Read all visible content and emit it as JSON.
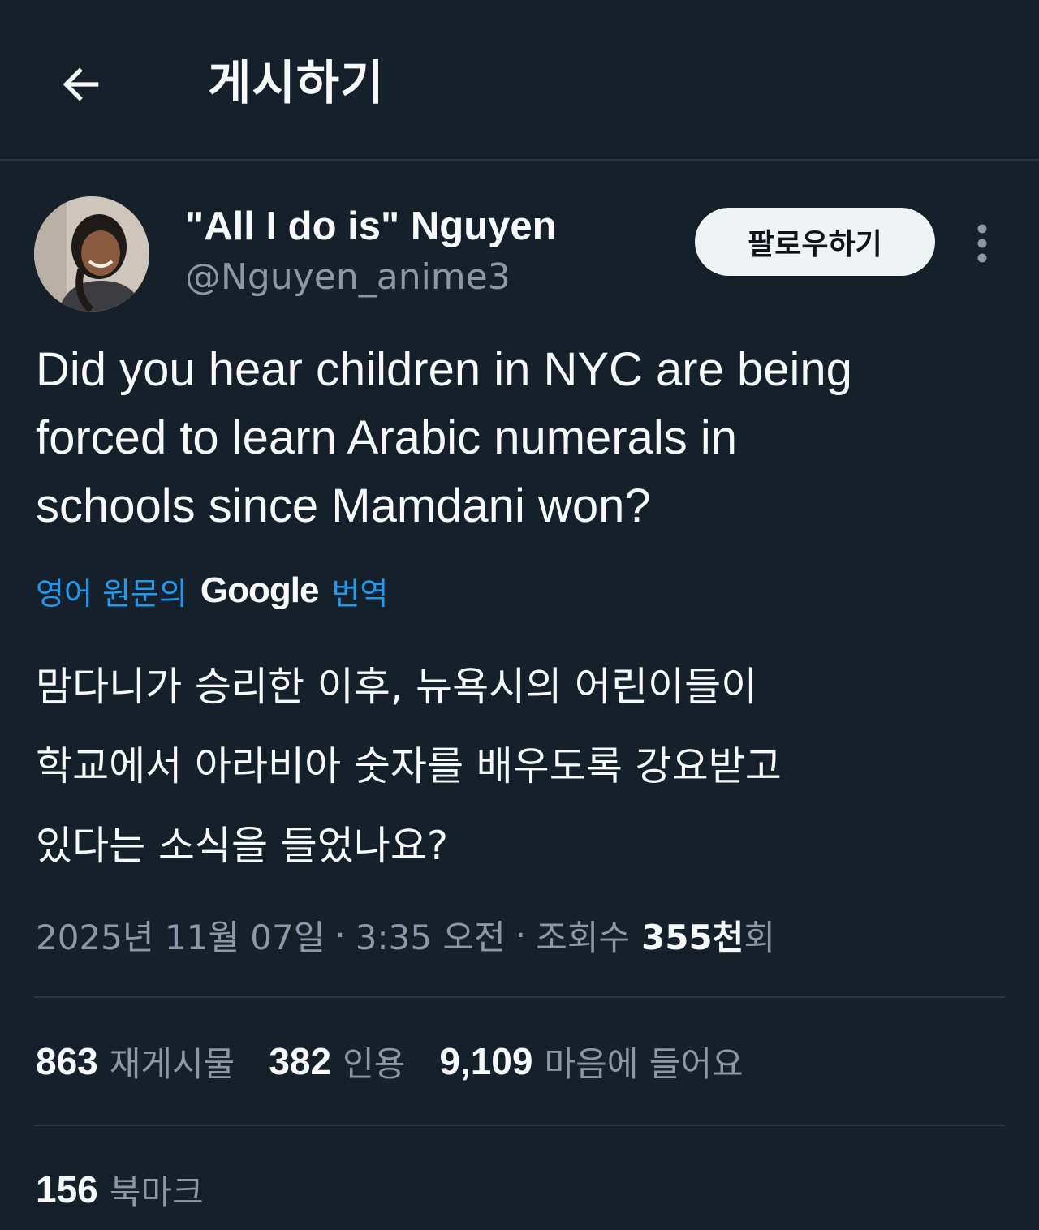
{
  "header": {
    "back_icon": "arrow-left-icon",
    "title": "게시하기"
  },
  "author": {
    "display_name": "\"All I do is\" Nguyen",
    "handle": "@Nguyen_anime3",
    "follow_label": "팔로우하기",
    "more_icon": "more-vertical-icon"
  },
  "tweet": {
    "text_lines": [
      "Did you hear children in NYC are being",
      "forced to learn Arabic numerals in",
      "schools since Mamdani won?"
    ],
    "translation_prefix": "영어 원문의",
    "translation_brand": "Google",
    "translation_suffix": "번역",
    "translated_lines": [
      "맘다니가 승리한 이후, 뉴욕시의 어린이들이",
      "학교에서 아라비아 숫자를 배우도록 강요받고",
      "있다는 소식을 들었나요?"
    ]
  },
  "meta": {
    "date": "2025년 11월 07일",
    "separator": "·",
    "time": "3:35 오전",
    "views_label": "조회수",
    "views_value": "355천",
    "views_suffix": "회"
  },
  "stats": {
    "reposts_count": "863",
    "reposts_label": "재게시물",
    "quotes_count": "382",
    "quotes_label": "인용",
    "likes_count": "9,109",
    "likes_label": "마음에 들어요",
    "bookmarks_count": "156",
    "bookmarks_label": "북마크"
  },
  "colors": {
    "background": "#15202b",
    "text": "#f7f9f9",
    "secondary": "#8b98a5",
    "link": "#1d9bf0",
    "divider": "#2c3640"
  }
}
